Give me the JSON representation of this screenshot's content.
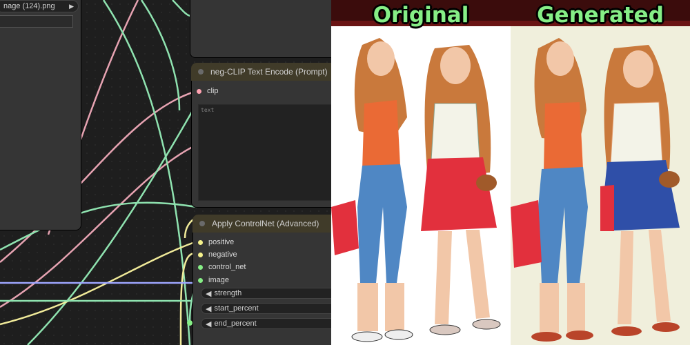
{
  "canvas": {
    "load_node": {
      "image_name": "nage (124).png"
    },
    "neg_clip_node": {
      "title": "neg-CLIP Text Encode (Prompt)",
      "input_clip": "clip",
      "text_placeholder": "text"
    },
    "controlnet_node": {
      "title": "Apply ControlNet (Advanced)",
      "inputs": [
        "positive",
        "negative",
        "control_net",
        "image"
      ],
      "widgets": [
        "strength",
        "start_percent",
        "end_percent"
      ]
    },
    "colors": {
      "node_bg": "#353535",
      "header_bg": "#403b29",
      "clip_slot": "#ffa2b1",
      "cond_slot": "#f5f28c",
      "image_slot": "#86ee86",
      "wire_pink": "#e7a3b2",
      "wire_green": "#8fe3b0",
      "wire_yellow": "#f1eb9a",
      "wire_blue": "#9ea6ff"
    }
  },
  "comparison": {
    "original_label": "Original",
    "generated_label": "Generated",
    "colors": {
      "label": "#86ee86",
      "original_bg": "#ffffff",
      "generated_bg": "#f0efdc",
      "banner": "#3b0c0c",
      "tank_top": "#ea6a35",
      "jeans": "#4f87c4",
      "skirt": "#e2303d",
      "hair": "#c9793c",
      "skin": "#f2c7a8"
    }
  }
}
